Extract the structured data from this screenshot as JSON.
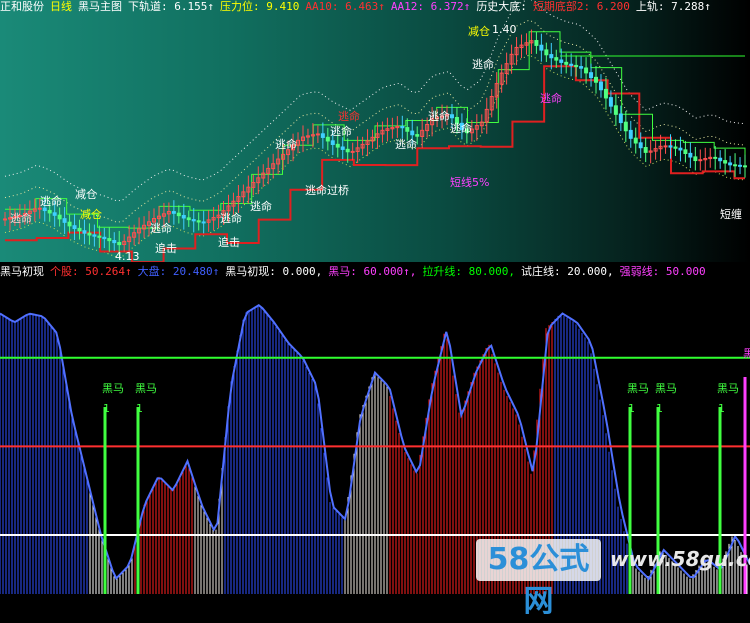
{
  "top": {
    "header": {
      "stock": "正和股份",
      "period": "日线",
      "indicator": "黑马主图",
      "lower_label": "下轨道: 6.155↑",
      "pressure_label": "压力位: 9.410",
      "aa10_label": "AA10: 6.463↑",
      "aa12_label": "AA12: 6.372↑",
      "hist_bottom_label": "历史大底:",
      "short_bottom_label": "短期底部2: 6.200",
      "upper_label": "上轨: 7.288↑"
    },
    "peak_label": "1.40",
    "low_label": "4.13",
    "annotations": {
      "taoming": "逃命",
      "jiancang": "减仓",
      "zhuiji": "追击",
      "guoqiao": "过桥",
      "duanxian": "短线5%",
      "lanque": "逃命过桥",
      "duanjia": "短缠"
    }
  },
  "bottom": {
    "header": {
      "indicator": "黑马初现",
      "stock_label": "个股: 50.264↑",
      "market_label": "大盘: 20.480↑",
      "hmcx_label": "黑马初现: 0.000,",
      "heima_label": "黑马: 60.000↑,",
      "lashen_label": "拉升线: 80.000,",
      "shizhuang_label": "试庄线: 20.000,",
      "qiangruo_label": "强弱线: 50.000"
    },
    "signals": [
      {
        "label": "黑马",
        "value": "1"
      },
      {
        "label": "黑马",
        "value": "1"
      },
      {
        "label": "黑马",
        "value": "1"
      },
      {
        "label": "黑马",
        "value": "1"
      },
      {
        "label": "黑马",
        "value": "1"
      }
    ],
    "right_mark": "黑"
  },
  "watermark": {
    "brand": "58公式网",
    "url": "www.58gu.com"
  },
  "colors": {
    "header_white": "#ffffff",
    "header_yellow": "#ffff00",
    "header_green": "#00ff00",
    "header_red": "#ff3030",
    "header_magenta": "#ff40ff",
    "red_channel": "#e02020",
    "green_line": "#30ff30",
    "blue_band": "#3050ff",
    "red_band": "#ff2020"
  },
  "chart_data": [
    {
      "type": "line",
      "title": "黑马主图",
      "series": [
        {
          "name": "下轨道",
          "values": [
            6.155
          ]
        },
        {
          "name": "压力位",
          "values": [
            9.41
          ]
        },
        {
          "name": "AA10",
          "values": [
            6.463
          ]
        },
        {
          "name": "AA12",
          "values": [
            6.372
          ]
        },
        {
          "name": "短期底部2",
          "values": [
            6.2
          ]
        },
        {
          "name": "上轨",
          "values": [
            7.288
          ]
        }
      ],
      "price_path": [
        4.8,
        4.9,
        5.1,
        4.9,
        4.6,
        4.4,
        4.3,
        4.13,
        4.5,
        4.8,
        5.0,
        4.8,
        4.7,
        4.9,
        5.3,
        5.7,
        6.1,
        6.5,
        6.9,
        7.0,
        6.7,
        6.5,
        6.8,
        7.1,
        7.2,
        6.9,
        7.4,
        7.5,
        7.0,
        7.3,
        8.4,
        9.2,
        9.4,
        9.0,
        8.8,
        8.7,
        8.3,
        7.6,
        6.9,
        6.5,
        6.7,
        6.6,
        6.3,
        6.4,
        6.2,
        6.155
      ]
    },
    {
      "type": "area",
      "title": "黑马初现",
      "series": [
        {
          "name": "个股",
          "values": [
            50.264
          ]
        },
        {
          "name": "大盘",
          "values": [
            20.48
          ]
        },
        {
          "name": "黑马初现",
          "values": [
            0
          ]
        },
        {
          "name": "黑马",
          "values": [
            60
          ]
        },
        {
          "name": "拉升线",
          "values": [
            80
          ]
        },
        {
          "name": "试庄线",
          "values": [
            20
          ]
        },
        {
          "name": "强弱线",
          "values": [
            50
          ]
        }
      ],
      "oscillator": [
        95,
        92,
        95,
        94,
        88,
        60,
        40,
        20,
        5,
        10,
        30,
        40,
        35,
        45,
        30,
        20,
        70,
        95,
        98,
        92,
        85,
        80,
        70,
        30,
        25,
        60,
        75,
        70,
        50,
        40,
        70,
        90,
        60,
        75,
        85,
        70,
        60,
        40,
        90,
        95,
        92,
        85,
        60,
        30,
        10,
        5,
        15,
        10,
        5,
        12,
        8,
        20,
        10
      ],
      "reference_lines": {
        "拉升线": 80,
        "强弱线": 50,
        "试庄线": 20
      }
    }
  ]
}
